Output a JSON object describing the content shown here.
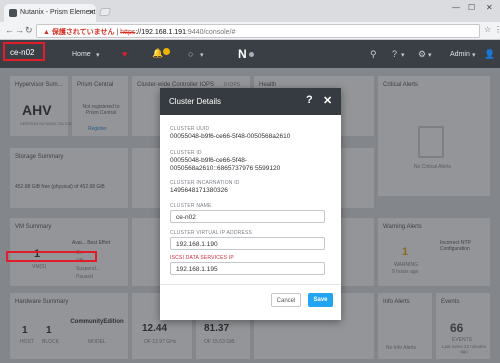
{
  "browser": {
    "tab_title": "Nutanix - Prism Element",
    "url_warning": "▲ 保護されていません",
    "url_scheme": "https",
    "url_host": "://192.168.1.191",
    "url_path": ":9440/console/#"
  },
  "prism": {
    "cluster_name": "ce-n02",
    "nav_home": "Home",
    "user": "Admin"
  },
  "dashboard": {
    "hypervisor_title": "Hypervisor Sum...",
    "hypervisor_value": "AHV",
    "hypervisor_sub": "VERSION NUTANIX 20170830",
    "prism_central_title": "Prism Central",
    "prism_central_text": "Not registered to Prism Central",
    "prism_central_link": "Register",
    "iops_title": "Cluster-wide Controller IOPS",
    "iops_value": "0 IOPS",
    "health_title": "Health",
    "critical_alerts_title": "Critical Alerts",
    "no_critical": "No Critical Alerts",
    "storage_title": "Storage Summary",
    "storage_text": "452.68 GiB free (physical) of 452.68 GiB",
    "vm_title": "VM Summary",
    "vm_count": "1",
    "vm_label": "VM(S)",
    "vm_avail": "Avai... Best Effort",
    "vm_states": [
      "On",
      "Off",
      "Suspend...",
      "Paused"
    ],
    "hardware_title": "Hardware Summary",
    "hosts": "1",
    "hosts_label": "HOST",
    "blocks": "1",
    "blocks_label": "BLOCK",
    "model": "CommunityEdition",
    "model_label": "MODEL",
    "cpu_pct": "12.44",
    "cpu_label": "OF 12.97 GHz",
    "mem_pct": "81.37",
    "mem_label": "OF 15.63 GiB",
    "warning_alerts_title": "Warning Alerts",
    "warning_count": "1",
    "warning_label": "WARNING",
    "warning_time": "9 hours ago",
    "warning_text": "Incorrect NTP Configuration",
    "info_alerts_title": "Info Alerts",
    "no_info": "No Info Alerts",
    "events_title": "Events",
    "events_count": "66",
    "events_label": "EVENTS",
    "events_time": "Last event 22 minutes ago"
  },
  "modal": {
    "title": "Cluster Details",
    "help": "?",
    "close": "✕",
    "uuid_label": "CLUSTER UUID",
    "uuid_value": "00055048-b9f6-ce66-5f48-0050568a2610",
    "id_label": "CLUSTER ID",
    "id_value_1": "00055048-b9f6-ce66-5f48-",
    "id_value_2": "0050568a2610::6865737976 5599120",
    "incarnation_label": "CLUSTER INCARNATION ID",
    "incarnation_value": "1495648171380326",
    "name_label": "CLUSTER NAME",
    "name_value": "ce-n02",
    "vip_label": "CLUSTER VIRTUAL IP ADDRESS",
    "vip_value": "192.168.1.190",
    "iscsi_label": "ISCSI DATA SERVICES IP",
    "iscsi_value": "192.168.1.195",
    "cancel": "Cancel",
    "save": "Save"
  },
  "colors": {
    "prism_bar": "#3a3f45",
    "save_button": "#22a5f0",
    "highlight_red": "#e21d2b"
  }
}
